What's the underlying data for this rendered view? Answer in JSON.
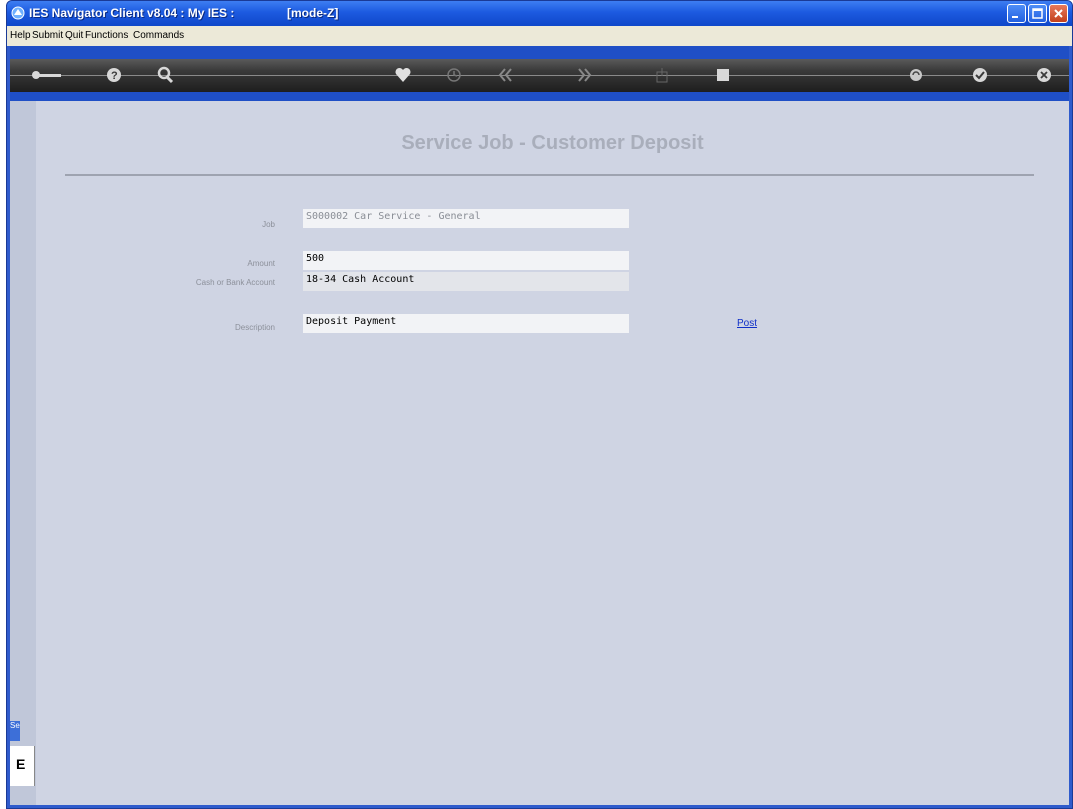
{
  "window": {
    "title": "IES Navigator Client v8.04 : My IES :",
    "mode": "[mode-Z]"
  },
  "menu": {
    "items": [
      "Help",
      "Submit",
      "Quit",
      "Functions",
      "Commands"
    ]
  },
  "toolbar": {
    "icons": [
      "key-icon",
      "help-icon",
      "search-icon",
      "heart-icon",
      "clock-icon",
      "rewind-icon",
      "fast-forward-icon",
      "export-icon",
      "stop-icon",
      "sync-icon",
      "check-icon",
      "close-icon"
    ]
  },
  "sidebar": {
    "tab_label": "Se",
    "tab2_label": "E"
  },
  "form": {
    "title": "Service Job - Customer Deposit",
    "job_label": "Job",
    "job_value": "S000002 Car Service - General",
    "amount_label": "Amount",
    "amount_value": "500",
    "account_label": "Cash or Bank Account",
    "account_value": "18-34 Cash Account",
    "description_label": "Description",
    "description_value": "Deposit Payment",
    "post_label": "Post"
  },
  "colors": {
    "titlebar": "#1c5ae0",
    "panel": "#cfd4e3",
    "link": "#1030c8"
  }
}
